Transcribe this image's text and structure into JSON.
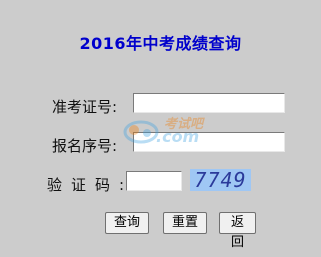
{
  "title": "2016年中考成绩查询",
  "form": {
    "exam_number_label": "准考证号:",
    "exam_number_value": "",
    "registration_number_label": "报名序号:",
    "registration_number_value": "",
    "captcha_label": "验证码:",
    "captcha_value": "",
    "captcha_image_text": "7749"
  },
  "buttons": {
    "query": "查询",
    "reset": "重置",
    "back": "返回"
  },
  "watermark": {
    "top_text": "考试吧",
    "bottom_text": ".com"
  },
  "colors": {
    "background": "#cccccc",
    "title": "#0000cc",
    "captcha_background": "#9fc7f4",
    "captcha_text": "#2b3a9a"
  }
}
